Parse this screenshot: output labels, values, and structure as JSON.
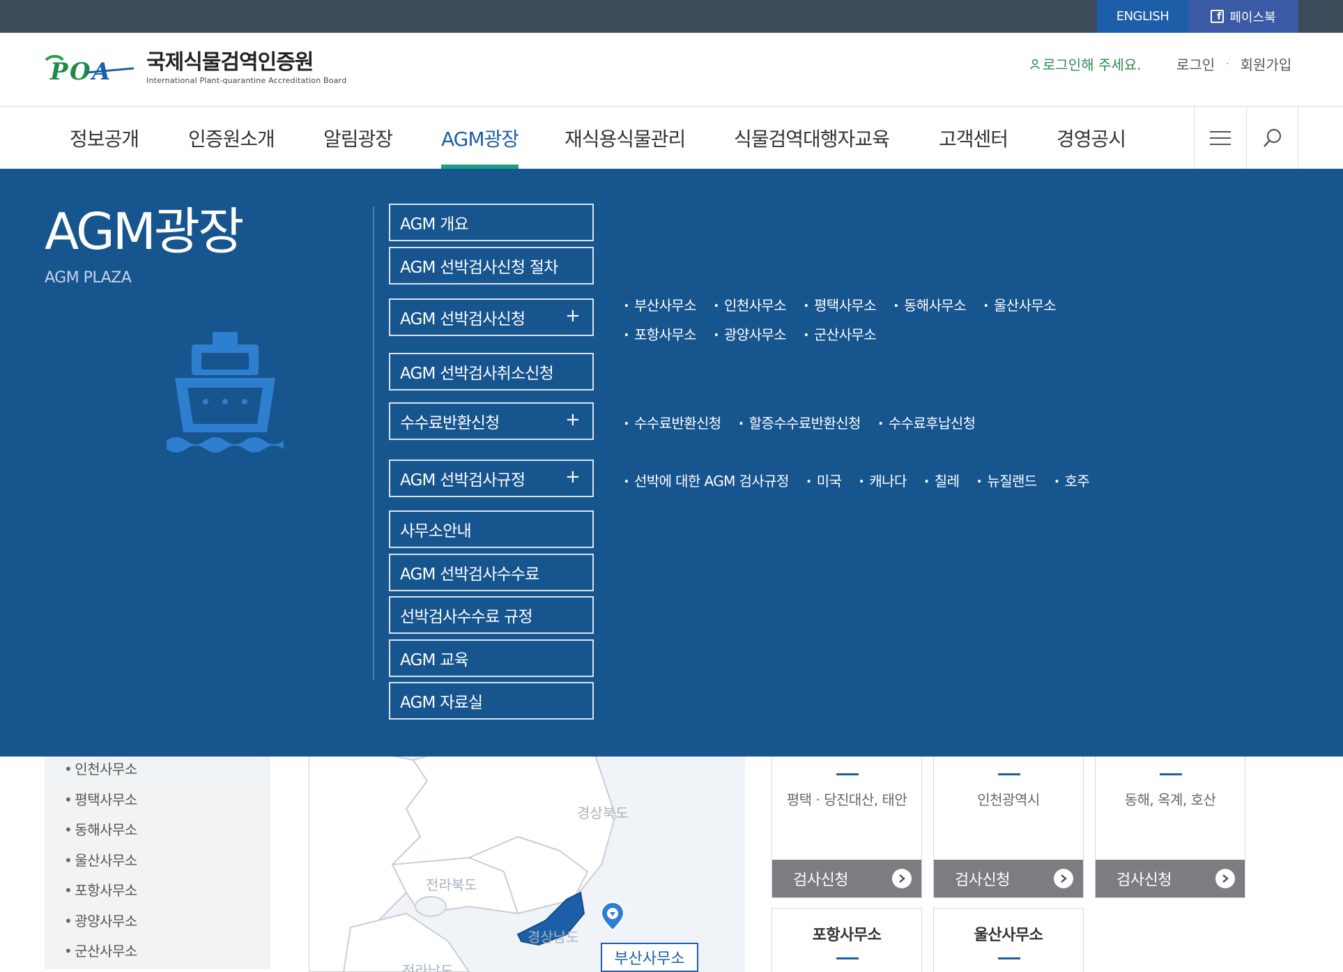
{
  "topbar": {
    "lang_label": "ENGLISH",
    "facebook_label": "페이스북"
  },
  "header": {
    "logo_name_ko": "국제식물검역인증원",
    "logo_name_en": "International Plant-quarantine Accreditation Board",
    "login_message": "로그인해 주세요.",
    "login_label": "로그인",
    "signup_label": "회원가입"
  },
  "nav": {
    "items": [
      {
        "label": "정보공개"
      },
      {
        "label": "인증원소개"
      },
      {
        "label": "알림광장"
      },
      {
        "label": "AGM광장"
      },
      {
        "label": "재식용식물관리"
      },
      {
        "label": "식물검역대행자교육"
      },
      {
        "label": "고객센터"
      },
      {
        "label": "경영공시"
      }
    ],
    "active_index": 3,
    "menu_icon": "hamburger-icon",
    "search_icon": "search-icon"
  },
  "mega_menu": {
    "title": "AGM광장",
    "subtitle": "AGM PLAZA",
    "illustration_icon": "ship-icon",
    "menu": [
      {
        "label": "AGM 개요",
        "expandable": false
      },
      {
        "label": "AGM 선박검사신청 절차",
        "expandable": false
      },
      {
        "label": "AGM 선박검사신청",
        "expandable": true,
        "toggle": "+"
      },
      {
        "label": "AGM 선박검사취소신청",
        "expandable": false
      },
      {
        "label": "수수료반환신청",
        "expandable": true,
        "toggle": "+"
      },
      {
        "label": "AGM 선박검사규정",
        "expandable": true,
        "toggle": "+"
      },
      {
        "label": "사무소안내",
        "expandable": false
      },
      {
        "label": "AGM 선박검사수수료",
        "expandable": false
      },
      {
        "label": "선박검사수수료 규정",
        "expandable": false
      },
      {
        "label": "AGM 교육",
        "expandable": false
      },
      {
        "label": "AGM 자료실",
        "expandable": false
      }
    ],
    "sub_inspection_offices_row1": [
      "부산사무소",
      "인천사무소",
      "평택사무소",
      "동해사무소",
      "울산사무소"
    ],
    "sub_inspection_offices_row2": [
      "포항사무소",
      "광양사무소",
      "군산사무소"
    ],
    "sub_refund": [
      "수수료반환신청",
      "할증수수료반환신청",
      "수수료후납신청"
    ],
    "sub_rules": [
      "선박에 대한 AGM 검사규정",
      "미국",
      "캐나다",
      "칠레",
      "뉴질랜드",
      "호주"
    ]
  },
  "background": {
    "office_list": [
      "인천사무소",
      "평택사무소",
      "동해사무소",
      "울산사무소",
      "포항사무소",
      "광양사무소",
      "군산사무소"
    ],
    "map": {
      "regions": [
        "경상북도",
        "전라북도",
        "경상남도",
        "전라남도"
      ],
      "marker_label": "부산사무소",
      "pin_icon": "location-pin-icon"
    },
    "cards": [
      {
        "location": "평택 · 당진대산, 태안",
        "button": "검사신청"
      },
      {
        "location": "인천광역시",
        "button": "검사신청"
      },
      {
        "location": "동해, 옥계, 호산",
        "button": "검사신청"
      }
    ],
    "cards_row2": [
      {
        "title": "포항사무소"
      },
      {
        "title": "울산사무소"
      }
    ]
  },
  "colors": {
    "topbar": "#3c4a5a",
    "english_bg": "#1d5ea8",
    "facebook_bg": "#3a5aa6",
    "mega_bg": "#17558f",
    "active_underline": "#1d9e86",
    "login_green": "#2e8a4e"
  }
}
